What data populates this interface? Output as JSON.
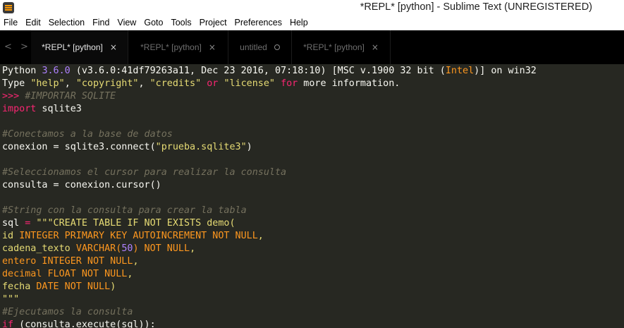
{
  "window": {
    "title": "*REPL* [python] - Sublime Text (UNREGISTERED)"
  },
  "menubar": {
    "items": [
      "File",
      "Edit",
      "Selection",
      "Find",
      "View",
      "Goto",
      "Tools",
      "Project",
      "Preferences",
      "Help"
    ]
  },
  "tabbar": {
    "nav_left": "<",
    "nav_right": ">",
    "close_glyph": "×",
    "tabs": [
      {
        "label": "*REPL* [python]",
        "active": true
      },
      {
        "label": "*REPL* [python]",
        "active": false
      },
      {
        "label": "untitled",
        "active": false
      },
      {
        "label": "*REPL* [python]",
        "active": false
      }
    ]
  },
  "colors": {
    "background": "#272822",
    "comment": "#75715e",
    "keyword": "#f92672",
    "string": "#e6db74",
    "number": "#ae81ff",
    "builtin": "#fd971f",
    "function": "#66d9ef",
    "text": "#f8f8f2"
  },
  "editor": {
    "lines": [
      [
        [
          "text",
          "Python "
        ],
        [
          "number",
          "3.6.0"
        ],
        [
          "text",
          " (v3.6.0:41df79263a11, Dec 23 2016, 07:18:10) [MSC v.1900 32 bit ("
        ],
        [
          "builtin",
          "Intel"
        ],
        [
          "text",
          ")] on win32"
        ]
      ],
      [
        [
          "text",
          "Type "
        ],
        [
          "string",
          "\"help\""
        ],
        [
          "text",
          ", "
        ],
        [
          "string",
          "\"copyright\""
        ],
        [
          "text",
          ", "
        ],
        [
          "string",
          "\"credits\""
        ],
        [
          "text",
          " "
        ],
        [
          "keyword",
          "or"
        ],
        [
          "text",
          " "
        ],
        [
          "string",
          "\"license\""
        ],
        [
          "text",
          " "
        ],
        [
          "keyword",
          "for"
        ],
        [
          "text",
          " more information."
        ]
      ],
      [
        [
          "prompt",
          ">>> "
        ],
        [
          "comment",
          "#IMPORTAR SQLITE"
        ]
      ],
      [
        [
          "keyword",
          "import"
        ],
        [
          "text",
          " sqlite3"
        ]
      ],
      [],
      [
        [
          "comment",
          "#Conectamos a la base de datos"
        ]
      ],
      [
        [
          "text",
          "conexion = sqlite3.connect("
        ],
        [
          "string",
          "\"prueba.sqlite3\""
        ],
        [
          "text",
          ")"
        ]
      ],
      [],
      [
        [
          "comment",
          "#Seleccionamos el cursor para realizar la consulta"
        ]
      ],
      [
        [
          "text",
          "consulta = conexion.cursor()"
        ]
      ],
      [],
      [
        [
          "comment",
          "#String con la consulta para crear la tabla"
        ]
      ],
      [
        [
          "text",
          "sql "
        ],
        [
          "keyword",
          "="
        ],
        [
          "text",
          " "
        ],
        [
          "string",
          "\"\"\"CREATE TABLE IF NOT EXISTS demo("
        ]
      ],
      [
        [
          "string",
          "id "
        ],
        [
          "builtin",
          "INTEGER PRIMARY KEY AUTOINCREMENT NOT NULL"
        ],
        [
          "string",
          ","
        ]
      ],
      [
        [
          "string",
          "cadena_texto "
        ],
        [
          "builtin",
          "VARCHAR("
        ],
        [
          "number",
          "50"
        ],
        [
          "builtin",
          ") NOT NULL"
        ],
        [
          "string",
          ","
        ]
      ],
      [
        [
          "builtin",
          "entero INTEGER NOT NULL"
        ],
        [
          "string",
          ","
        ]
      ],
      [
        [
          "builtin",
          "decimal FLOAT NOT NULL"
        ],
        [
          "string",
          ","
        ]
      ],
      [
        [
          "string",
          "fecha "
        ],
        [
          "builtin",
          "DATE NOT NULL"
        ],
        [
          "string",
          ")"
        ]
      ],
      [
        [
          "string",
          "\"\"\""
        ]
      ],
      [
        [
          "comment",
          "#Ejecutamos la consulta"
        ]
      ],
      [
        [
          "keyword",
          "if"
        ],
        [
          "text",
          " (consulta.execute(sql)):"
        ]
      ]
    ]
  }
}
